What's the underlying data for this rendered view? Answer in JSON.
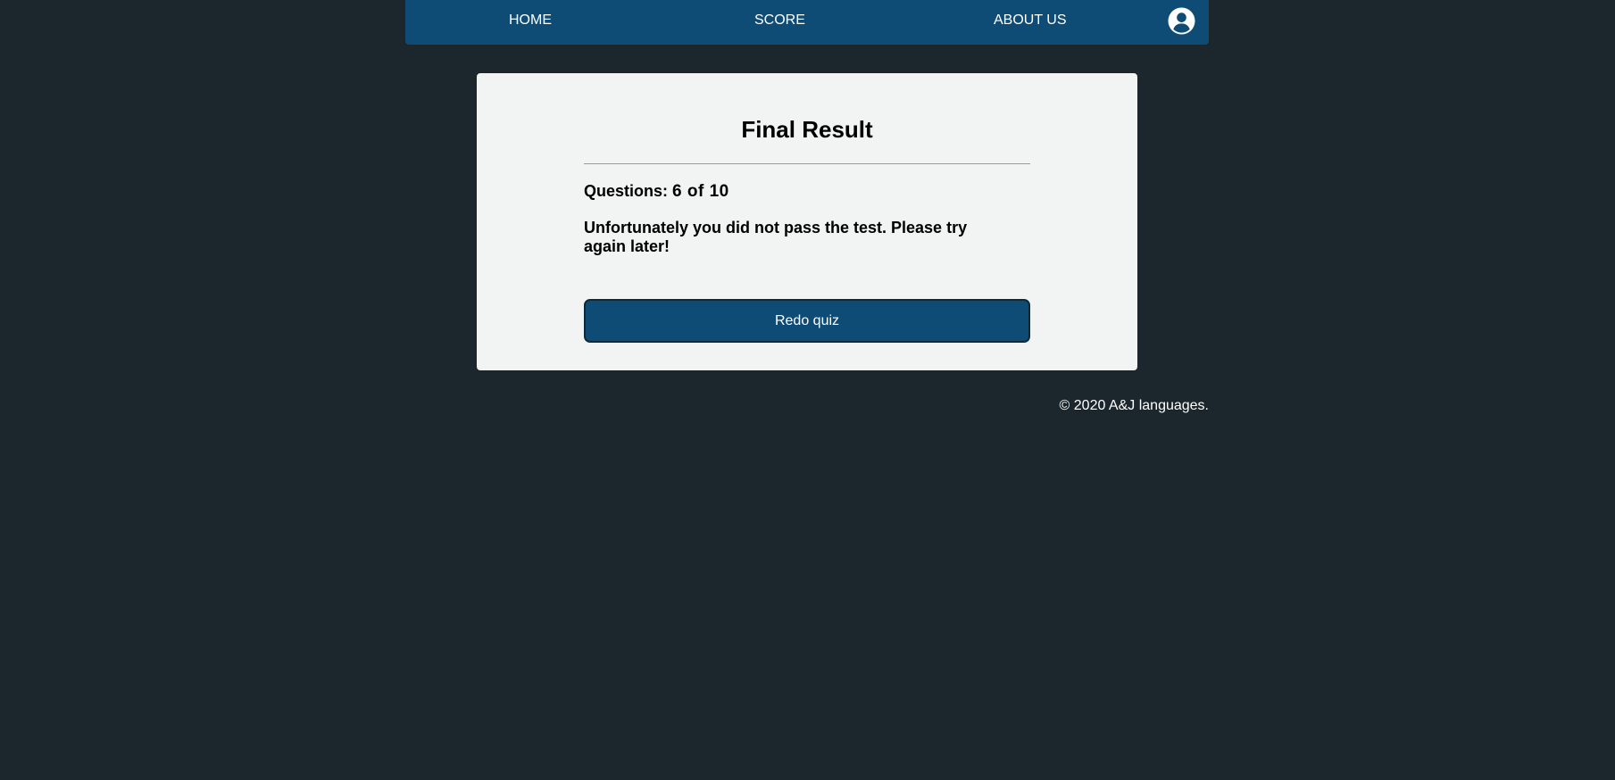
{
  "navbar": {
    "home_label": "HOME",
    "score_label": "SCORE",
    "about_label": "ABOUT US",
    "avatar_icon": "user-circle-icon"
  },
  "result": {
    "title": "Final Result",
    "questions_label": "Questions: ",
    "questions_value": "6 of 10",
    "message": "Unfortunately you did not pass the test. Please try again later!",
    "redo_button_label": "Redo quiz"
  },
  "footer": {
    "copyright": "© 2020 A&J languages."
  },
  "colors": {
    "background": "#1b262d",
    "primary": "#0f4c75",
    "card": "#f2f4f3"
  }
}
